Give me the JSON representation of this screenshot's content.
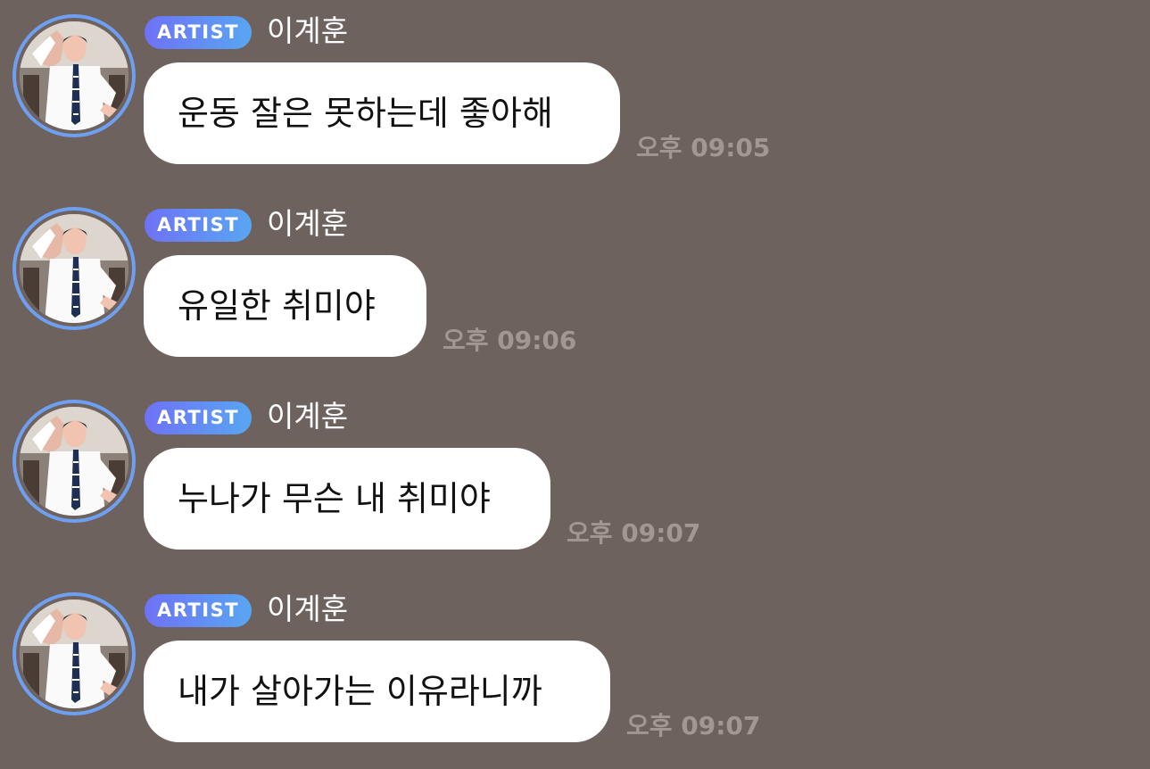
{
  "messages": [
    {
      "badge": "ARTIST",
      "sender": "이계훈",
      "text": "운동 잘은 못하는데 좋아해",
      "time": "오후 09:05"
    },
    {
      "badge": "ARTIST",
      "sender": "이계훈",
      "text": "유일한 취미야",
      "time": "오후 09:06"
    },
    {
      "badge": "ARTIST",
      "sender": "이계훈",
      "text": "누나가 무슨 내 취미야",
      "time": "오후 09:07"
    },
    {
      "badge": "ARTIST",
      "sender": "이계훈",
      "text": "내가 살아가는 이유라니까",
      "time": "오후 09:07"
    }
  ],
  "colors": {
    "background": "#6d625d",
    "bubble": "#ffffff",
    "badge_gradient_start": "#6f72f5",
    "badge_gradient_end": "#58a6f2",
    "avatar_ring": "#6e9ff0",
    "timestamp": "#a39793"
  },
  "icons": {
    "avatar": "artist-profile-photo"
  }
}
